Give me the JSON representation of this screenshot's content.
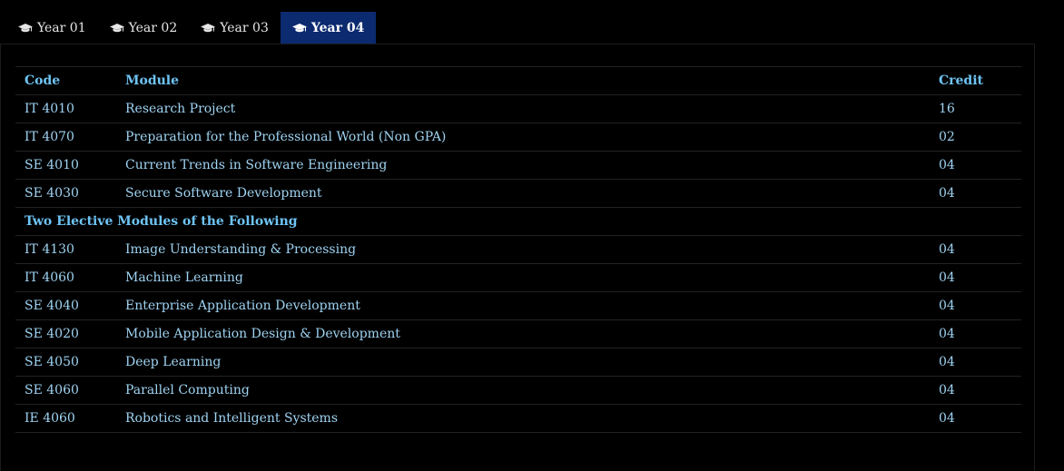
{
  "tabs": [
    {
      "label": "Year 01",
      "active": false
    },
    {
      "label": "Year 02",
      "active": false
    },
    {
      "label": "Year 03",
      "active": false
    },
    {
      "label": "Year 04",
      "active": true
    }
  ],
  "table": {
    "headers": {
      "code": "Code",
      "module": "Module",
      "credit": "Credit"
    },
    "core_rows": [
      {
        "code": "IT 4010",
        "module": "Research Project",
        "credit": "16"
      },
      {
        "code": "IT 4070",
        "module": "Preparation for the Professional World (Non GPA)",
        "credit": "02"
      },
      {
        "code": "SE 4010",
        "module": "Current Trends in Software Engineering",
        "credit": "04"
      },
      {
        "code": "SE 4030",
        "module": "Secure Software Development",
        "credit": "04"
      }
    ],
    "section_label": "Two Elective Modules of the Following",
    "elective_rows": [
      {
        "code": "IT 4130",
        "module": "Image Understanding & Processing",
        "credit": "04"
      },
      {
        "code": "IT 4060",
        "module": "Machine Learning",
        "credit": "04"
      },
      {
        "code": "SE 4040",
        "module": "Enterprise Application Development",
        "credit": "04"
      },
      {
        "code": "SE 4020",
        "module": "Mobile Application Design & Development",
        "credit": "04"
      },
      {
        "code": "SE 4050",
        "module": "Deep Learning",
        "credit": "04"
      },
      {
        "code": "SE 4060",
        "module": "Parallel Computing",
        "credit": "04"
      },
      {
        "code": "IE 4060",
        "module": "Robotics and Intelligent Systems",
        "credit": "04"
      }
    ]
  }
}
